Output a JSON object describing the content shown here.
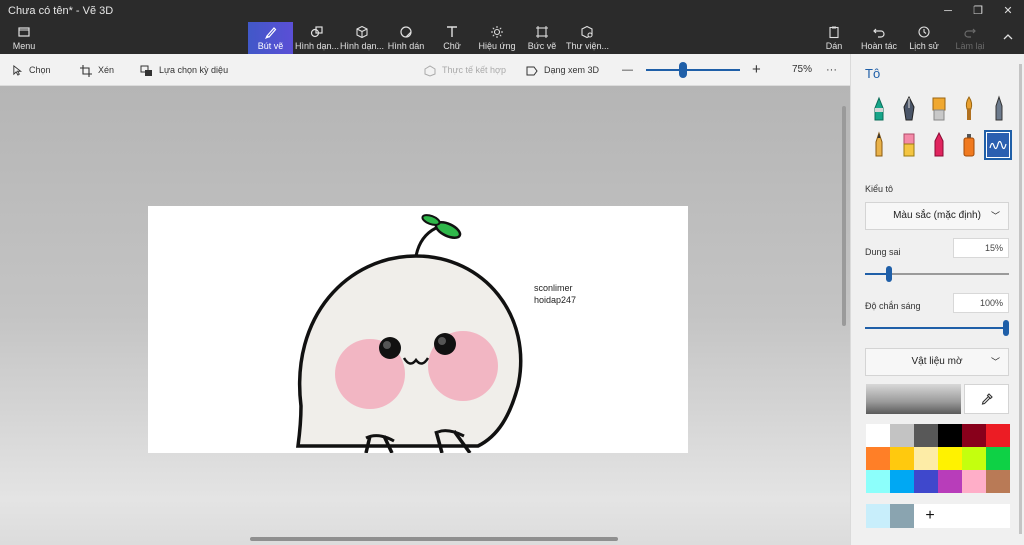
{
  "window": {
    "title": "Chưa có tên* - Vẽ 3D"
  },
  "ribbon": {
    "menu": "Menu",
    "brushes": "Bút vẽ",
    "shapes2d": "Hình dạn...",
    "shapes3d": "Hình dạn...",
    "stickers": "Hình dán",
    "text": "Chữ",
    "effects": "Hiệu ứng",
    "canvas": "Bức vẽ",
    "library": "Thư viện...",
    "paste": "Dán",
    "undo": "Hoàn tác",
    "history": "Lịch sử",
    "redo": "Làm lại"
  },
  "toolbar": {
    "select": "Chọn",
    "crop": "Xén",
    "magic_select": "Lựa chọn kỳ diệu",
    "mixed_reality": "Thực tế kết hợp",
    "view_3d": "Dạng xem 3D",
    "zoom_minus": "—",
    "zoom_plus": "+",
    "zoom_level": "75%",
    "zoom_fraction": 0.38,
    "more": "···"
  },
  "canvas": {
    "text_line1": "sconlimer",
    "text_line2": "hoidap247"
  },
  "panel": {
    "title": "Tô",
    "fill_type_label": "Kiểu tô",
    "fill_type_value": "Màu sắc (mặc định)",
    "tolerance_label": "Dung sai",
    "tolerance_value": "15%",
    "tolerance_fraction": 0.15,
    "opacity_label": "Độ chắn sáng",
    "opacity_value": "100%",
    "opacity_fraction": 1.0,
    "material_value": "Vật liệu mờ",
    "add_color": "+"
  },
  "palette": [
    "#ffffff",
    "#c3c3c3",
    "#585858",
    "#000000",
    "#88001b",
    "#ec1c24",
    "#ff7f27",
    "#ffc90e",
    "#fdeca6",
    "#fff200",
    "#c4ff0e",
    "#0ed145",
    "#8cfffb",
    "#00a8f3",
    "#3f48cc",
    "#b83dba",
    "#ffaec8",
    "#b97a56"
  ],
  "custom_colors": [
    "#c8eefb",
    "#8aa4b0"
  ],
  "colors": {
    "accent": "#1f5fa8",
    "active_tab": "#4c55d0"
  }
}
